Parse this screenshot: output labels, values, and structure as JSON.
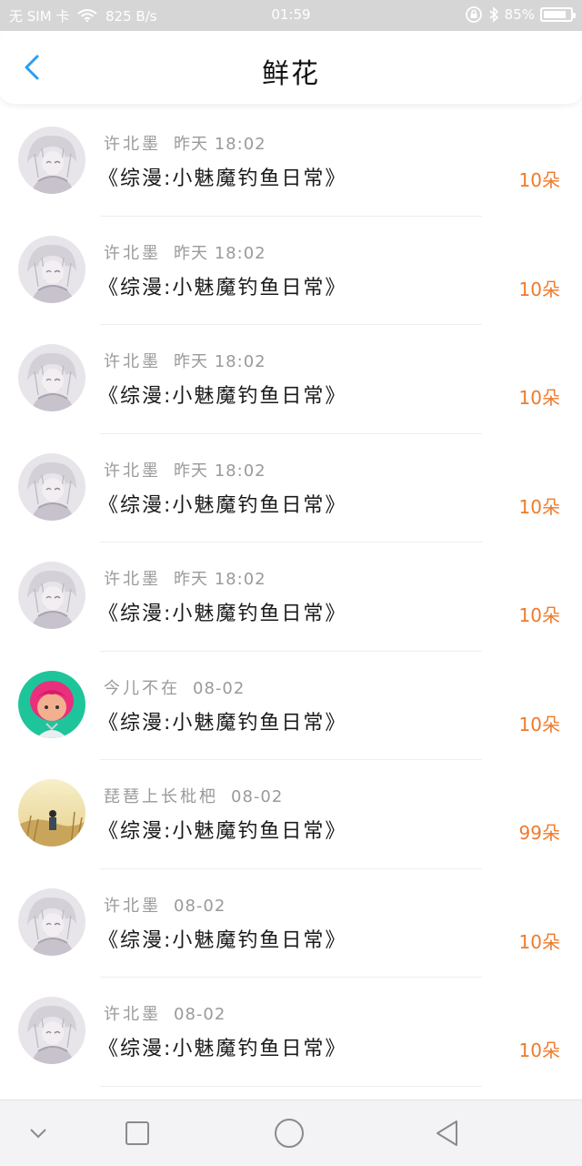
{
  "status_bar": {
    "carrier": "无 SIM 卡",
    "net_speed": "825 B/s",
    "time": "01:59",
    "battery": "85%",
    "battery_level": 0.85
  },
  "header": {
    "title": "鲜花",
    "back_icon": "chevron-left-icon",
    "accent_color": "#2a9df4"
  },
  "records": [
    {
      "avatar": "silver-hair",
      "name": "许北墨",
      "time": "昨天 18:02",
      "title": "《综漫:小魅魔钓鱼日常》",
      "count": "10朵"
    },
    {
      "avatar": "silver-hair",
      "name": "许北墨",
      "time": "昨天 18:02",
      "title": "《综漫:小魅魔钓鱼日常》",
      "count": "10朵"
    },
    {
      "avatar": "silver-hair",
      "name": "许北墨",
      "time": "昨天 18:02",
      "title": "《综漫:小魅魔钓鱼日常》",
      "count": "10朵"
    },
    {
      "avatar": "silver-hair",
      "name": "许北墨",
      "time": "昨天 18:02",
      "title": "《综漫:小魅魔钓鱼日常》",
      "count": "10朵"
    },
    {
      "avatar": "silver-hair",
      "name": "许北墨",
      "time": "昨天 18:02",
      "title": "《综漫:小魅魔钓鱼日常》",
      "count": "10朵"
    },
    {
      "avatar": "pink-hair",
      "name": "今儿不在",
      "time": "08-02",
      "title": "《综漫:小魅魔钓鱼日常》",
      "count": "10朵"
    },
    {
      "avatar": "scenery",
      "name": "琵琶上长枇杷",
      "time": "08-02",
      "title": "《综漫:小魅魔钓鱼日常》",
      "count": "99朵"
    },
    {
      "avatar": "silver-hair",
      "name": "许北墨",
      "time": "08-02",
      "title": "《综漫:小魅魔钓鱼日常》",
      "count": "10朵"
    },
    {
      "avatar": "silver-hair",
      "name": "许北墨",
      "time": "08-02",
      "title": "《综漫:小魅魔钓鱼日常》",
      "count": "10朵"
    }
  ],
  "count_color": "#f07a2a",
  "nav_bar": {
    "icons": [
      "chevron-down-icon",
      "square-icon",
      "circle-icon",
      "triangle-back-icon"
    ]
  }
}
